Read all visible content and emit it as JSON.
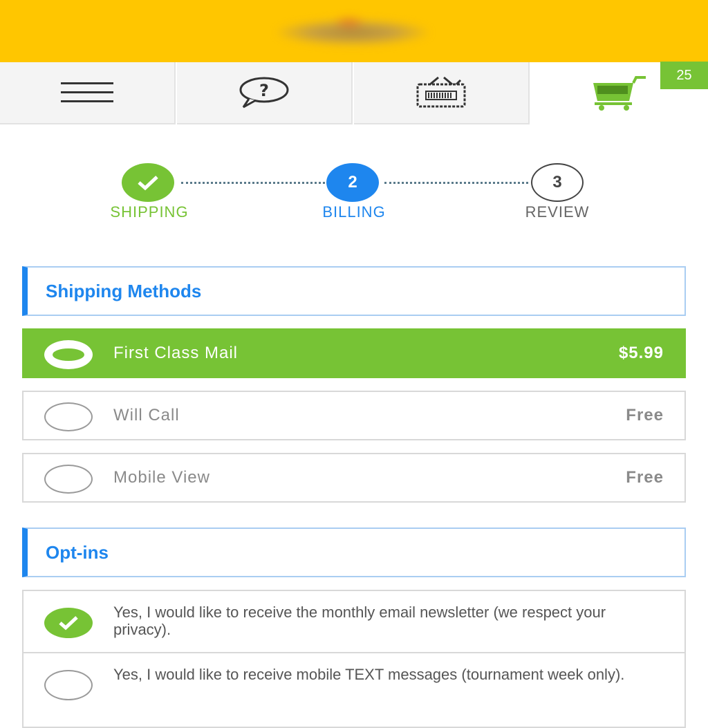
{
  "header": {
    "logo_icon": "brand-logo"
  },
  "nav": {
    "menu_icon": "hamburger-menu-icon",
    "help_icon": "help-speech-bubble-icon",
    "tickets_icon": "ticket-tv-icon",
    "cart_icon": "shopping-cart-icon",
    "cart_count": "25"
  },
  "steps": [
    {
      "number": "",
      "label": "SHIPPING",
      "state": "complete"
    },
    {
      "number": "2",
      "label": "BILLING",
      "state": "active"
    },
    {
      "number": "3",
      "label": "REVIEW",
      "state": "pending"
    }
  ],
  "shipping": {
    "title": "Shipping Methods",
    "options": [
      {
        "label": "First Class Mail",
        "price": "$5.99",
        "selected": true
      },
      {
        "label": "Will Call",
        "price": "Free",
        "selected": false
      },
      {
        "label": "Mobile View",
        "price": "Free",
        "selected": false
      }
    ]
  },
  "optins": {
    "title": "Opt-ins",
    "items": [
      {
        "text": "Yes, I would like to receive the monthly email newsletter (we respect your privacy).",
        "checked": true
      },
      {
        "text": "Yes, I would like to receive mobile TEXT messages (tournament week only).",
        "checked": false
      }
    ]
  },
  "colors": {
    "brand_yellow": "#ffc600",
    "green": "#77c335",
    "blue": "#1e86ee"
  }
}
